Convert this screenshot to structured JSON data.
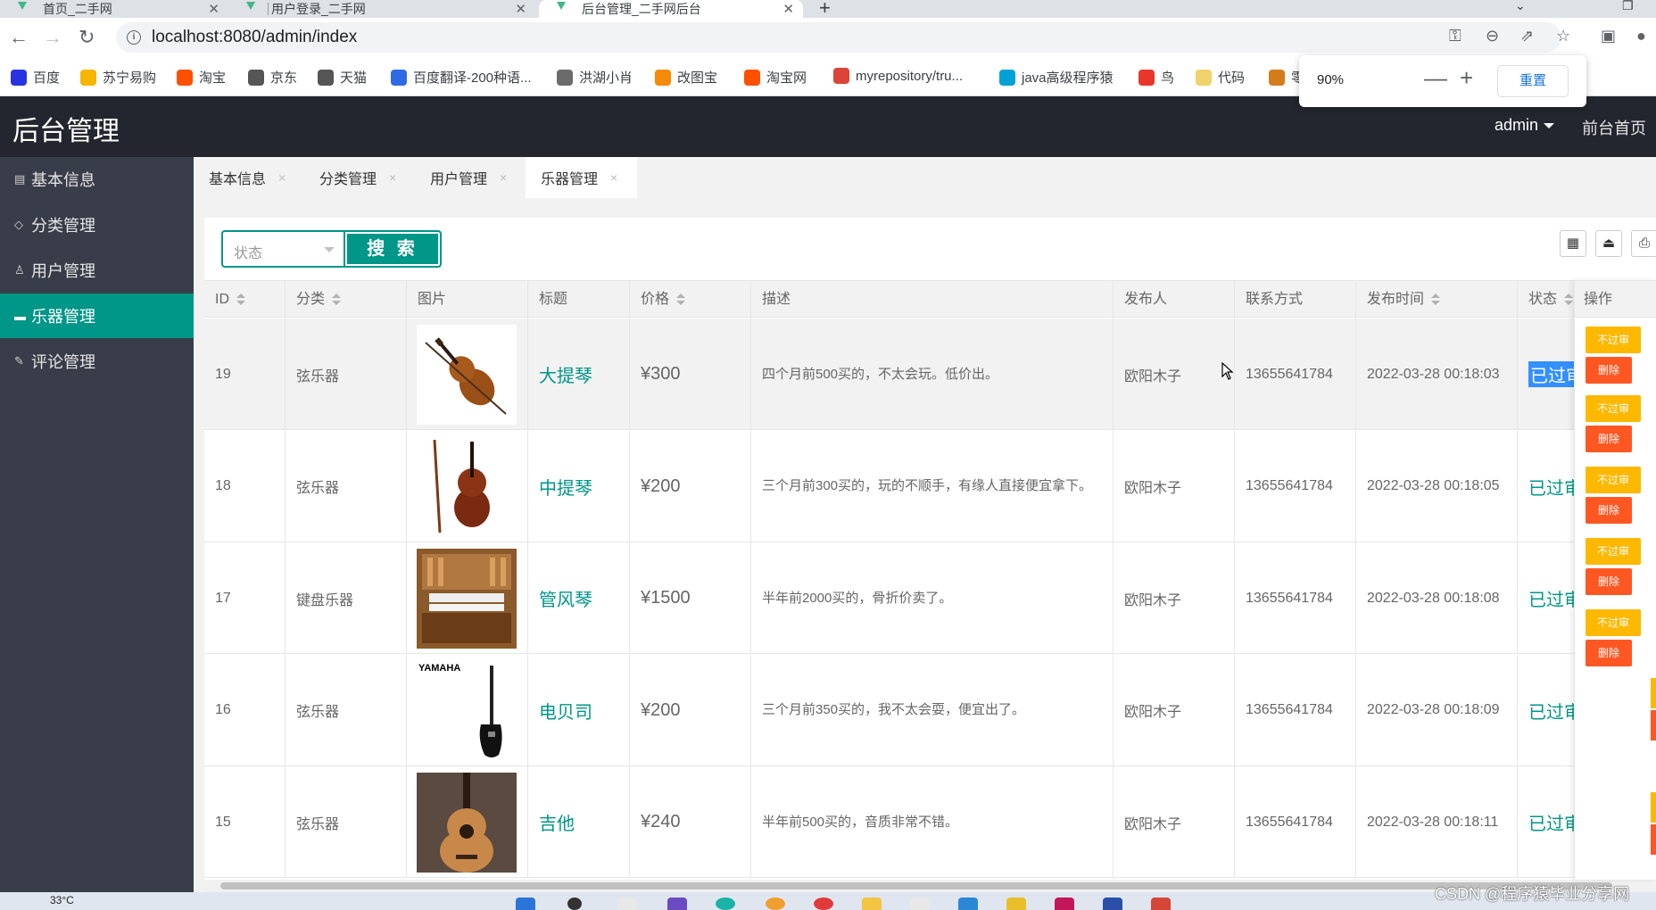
{
  "browser": {
    "tabs": [
      {
        "title": "首页_二手网"
      },
      {
        "title": "用户登录_二手网"
      },
      {
        "title": "后台管理_二手网后台"
      }
    ],
    "url": "localhost:8080/admin/index",
    "bookmarks": [
      {
        "label": "百度",
        "icon": "baidu-icon",
        "color": "#2932e1"
      },
      {
        "label": "苏宁易购",
        "icon": "suning-icon",
        "color": "#f6b500"
      },
      {
        "label": "淘宝",
        "icon": "taobao-icon",
        "color": "#ff5000"
      },
      {
        "label": "京东",
        "icon": "globe-icon",
        "color": "#555555"
      },
      {
        "label": "天猫",
        "icon": "globe-icon",
        "color": "#555555"
      },
      {
        "label": "百度翻译-200种语...",
        "icon": "baidu-translate-icon",
        "color": "#2f6ae6"
      },
      {
        "label": "洪湖小肖",
        "icon": "bird-icon",
        "color": "#6b6b6b"
      },
      {
        "label": "改图宝",
        "icon": "gaitubao-icon",
        "color": "#f58a07"
      },
      {
        "label": "淘宝网",
        "icon": "taobao-icon",
        "color": "#ff5000"
      },
      {
        "label": "myrepository/tru...",
        "icon": "chrome-icon",
        "color": "#db4437"
      },
      {
        "label": "java高级程序猿",
        "icon": "bilibili-icon",
        "color": "#00a1d6"
      },
      {
        "label": "鸟",
        "icon": "bird-red-icon",
        "color": "#e8372a"
      },
      {
        "label": "代码",
        "icon": "moon-icon",
        "color": "#f1d36b"
      },
      {
        "label": "零",
        "icon": "fox-icon",
        "color": "#d47b1c"
      }
    ],
    "zoom": {
      "percent": "90%",
      "minus": "—",
      "plus": "+",
      "reset": "重置"
    }
  },
  "header": {
    "logo": "后台管理",
    "user": "admin",
    "front_link": "前台首页"
  },
  "sidebar": {
    "items": [
      {
        "label": "基本信息",
        "icon": "doc-icon",
        "glyph": "▤"
      },
      {
        "label": "分类管理",
        "icon": "tag-icon",
        "glyph": "◇"
      },
      {
        "label": "用户管理",
        "icon": "user-icon",
        "glyph": "♙"
      },
      {
        "label": "乐器管理",
        "icon": "chat-icon",
        "glyph": "▬"
      },
      {
        "label": "评论管理",
        "icon": "edit-icon",
        "glyph": "✎"
      }
    ],
    "active_index": 3
  },
  "content_tabs": [
    {
      "label": "基本信息",
      "close": "×"
    },
    {
      "label": "分类管理",
      "close": "×"
    },
    {
      "label": "用户管理",
      "close": "×"
    },
    {
      "label": "乐器管理",
      "close": "×"
    }
  ],
  "filter": {
    "status_placeholder": "状态",
    "search_label": "搜 索"
  },
  "toolbar_icons": [
    "columns-icon",
    "export-icon",
    "print-icon"
  ],
  "table": {
    "headers": {
      "id": "ID",
      "category": "分类",
      "image": "图片",
      "title": "标题",
      "price": "价格",
      "description": "描述",
      "publisher": "发布人",
      "contact": "联系方式",
      "time": "发布时间",
      "status": "状态",
      "ops": "操作"
    },
    "rows": [
      {
        "id": "19",
        "category": "弦乐器",
        "image": "cello-image",
        "title": "大提琴",
        "price": "¥300",
        "description": "四个月前500买的，不太会玩。低价出。",
        "publisher": "欧阳木子",
        "contact": "13655641784",
        "time": "2022-03-28 00:18:03",
        "status": "已过审"
      },
      {
        "id": "18",
        "category": "弦乐器",
        "image": "viola-image",
        "title": "中提琴",
        "price": "¥200",
        "description": "三个月前300买的，玩的不顺手，有缘人直接便宜拿下。",
        "publisher": "欧阳木子",
        "contact": "13655641784",
        "time": "2022-03-28 00:18:05",
        "status": "已过审"
      },
      {
        "id": "17",
        "category": "键盘乐器",
        "image": "organ-image",
        "title": "管风琴",
        "price": "¥1500",
        "description": "半年前2000买的，骨折价卖了。",
        "publisher": "欧阳木子",
        "contact": "13655641784",
        "time": "2022-03-28 00:18:08",
        "status": "已过审"
      },
      {
        "id": "16",
        "category": "弦乐器",
        "image": "bass-image",
        "title": "电贝司",
        "price": "¥200",
        "description": "三个月前350买的，我不太会耍，便宜出了。",
        "publisher": "欧阳木子",
        "contact": "13655641784",
        "time": "2022-03-28 00:18:09",
        "status": "已过审"
      },
      {
        "id": "15",
        "category": "弦乐器",
        "image": "guitar-image",
        "title": "吉他",
        "price": "¥240",
        "description": "半年前500买的，音质非常不错。",
        "publisher": "欧阳木子",
        "contact": "13655641784",
        "time": "2022-03-28 00:18:11",
        "status": "已过审"
      }
    ],
    "ops": {
      "reject": "不过审",
      "delete": "删除"
    },
    "yamaha_text": "YAMAHA"
  },
  "taskbar": {
    "weather": "33°C"
  },
  "watermark": "CSDN @程序猿毕业分享网",
  "colors": {
    "accent": "#009688",
    "header": "#23262e",
    "sidebar": "#393d49",
    "warn": "#ffb800",
    "danger": "#ff5722"
  }
}
